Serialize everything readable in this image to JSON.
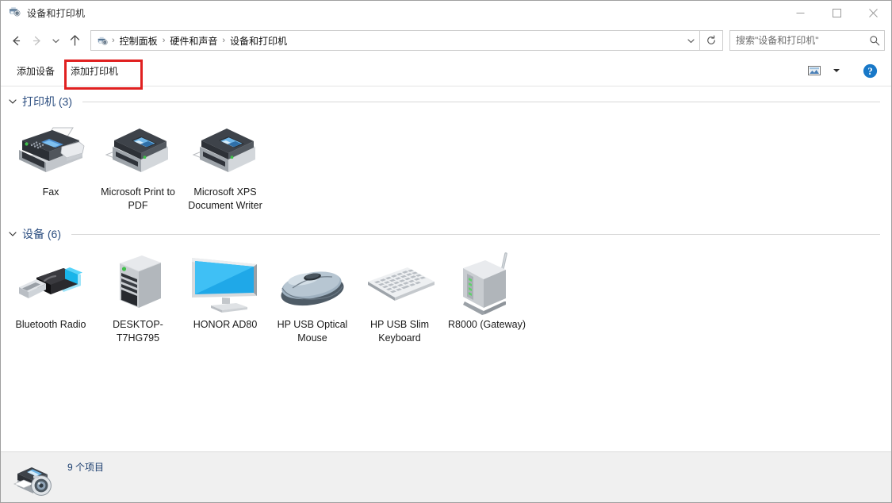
{
  "window": {
    "title": "设备和打印机",
    "title_icon": "devices-printers-icon",
    "controls": {
      "minimize": "minimize-icon",
      "maximize": "maximize-icon",
      "close": "close-icon"
    }
  },
  "address_bar": {
    "back": "back-arrow-icon",
    "forward": "forward-arrow-icon",
    "history": "chevron-down-icon",
    "up": "up-arrow-icon",
    "breadcrumbs": [
      {
        "label": "控制面板"
      },
      {
        "label": "硬件和声音"
      },
      {
        "label": "设备和打印机"
      }
    ],
    "separator": "›",
    "dropdown": "chevron-down-icon",
    "refresh": "refresh-icon"
  },
  "search": {
    "placeholder": "搜索\"设备和打印机\"",
    "value": "",
    "icon": "search-icon"
  },
  "command_bar": {
    "items": [
      {
        "label": "添加设备",
        "name": "add-device-button",
        "highlighted": false
      },
      {
        "label": "添加打印机",
        "name": "add-printer-button",
        "highlighted": true
      }
    ],
    "view_icon": "preview-pane-icon",
    "view_dropdown": "chevron-down-icon",
    "help_icon": "help-icon",
    "highlight_color": "#e02020"
  },
  "groups": [
    {
      "name": "printers-group",
      "title": "打印机 (3)",
      "chevron": "chevron-down-icon",
      "items": [
        {
          "label": "Fax",
          "icon": "fax-machine-icon"
        },
        {
          "label": "Microsoft Print to PDF",
          "icon": "printer-icon"
        },
        {
          "label": "Microsoft XPS Document Writer",
          "icon": "printer-icon"
        }
      ]
    },
    {
      "name": "devices-group",
      "title": "设备 (6)",
      "chevron": "chevron-down-icon",
      "items": [
        {
          "label": "Bluetooth Radio",
          "icon": "usb-bluetooth-dongle-icon"
        },
        {
          "label": "DESKTOP-T7HG795",
          "icon": "desktop-tower-icon"
        },
        {
          "label": "HONOR AD80",
          "icon": "monitor-icon"
        },
        {
          "label": "HP USB Optical Mouse",
          "icon": "mouse-icon"
        },
        {
          "label": "HP USB Slim Keyboard",
          "icon": "keyboard-icon"
        },
        {
          "label": "R8000 (Gateway)",
          "icon": "router-icon"
        }
      ]
    }
  ],
  "status_bar": {
    "icon": "devices-printers-icon",
    "text": "9 个项目"
  },
  "colors": {
    "group_title": "#2c4e80",
    "status_text": "#1b3e6f",
    "accent_blue": "#1878c8",
    "highlight_red": "#e02020"
  }
}
